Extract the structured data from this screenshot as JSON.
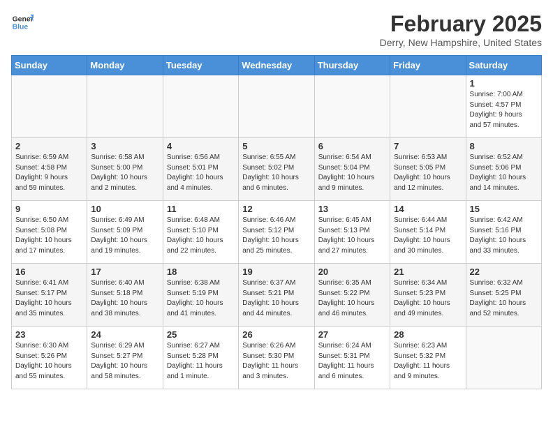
{
  "header": {
    "logo_line1": "General",
    "logo_line2": "Blue",
    "title": "February 2025",
    "subtitle": "Derry, New Hampshire, United States"
  },
  "days_of_week": [
    "Sunday",
    "Monday",
    "Tuesday",
    "Wednesday",
    "Thursday",
    "Friday",
    "Saturday"
  ],
  "weeks": [
    [
      {
        "day": "",
        "info": ""
      },
      {
        "day": "",
        "info": ""
      },
      {
        "day": "",
        "info": ""
      },
      {
        "day": "",
        "info": ""
      },
      {
        "day": "",
        "info": ""
      },
      {
        "day": "",
        "info": ""
      },
      {
        "day": "1",
        "info": "Sunrise: 7:00 AM\nSunset: 4:57 PM\nDaylight: 9 hours\nand 57 minutes."
      }
    ],
    [
      {
        "day": "2",
        "info": "Sunrise: 6:59 AM\nSunset: 4:58 PM\nDaylight: 9 hours\nand 59 minutes."
      },
      {
        "day": "3",
        "info": "Sunrise: 6:58 AM\nSunset: 5:00 PM\nDaylight: 10 hours\nand 2 minutes."
      },
      {
        "day": "4",
        "info": "Sunrise: 6:56 AM\nSunset: 5:01 PM\nDaylight: 10 hours\nand 4 minutes."
      },
      {
        "day": "5",
        "info": "Sunrise: 6:55 AM\nSunset: 5:02 PM\nDaylight: 10 hours\nand 6 minutes."
      },
      {
        "day": "6",
        "info": "Sunrise: 6:54 AM\nSunset: 5:04 PM\nDaylight: 10 hours\nand 9 minutes."
      },
      {
        "day": "7",
        "info": "Sunrise: 6:53 AM\nSunset: 5:05 PM\nDaylight: 10 hours\nand 12 minutes."
      },
      {
        "day": "8",
        "info": "Sunrise: 6:52 AM\nSunset: 5:06 PM\nDaylight: 10 hours\nand 14 minutes."
      }
    ],
    [
      {
        "day": "9",
        "info": "Sunrise: 6:50 AM\nSunset: 5:08 PM\nDaylight: 10 hours\nand 17 minutes."
      },
      {
        "day": "10",
        "info": "Sunrise: 6:49 AM\nSunset: 5:09 PM\nDaylight: 10 hours\nand 19 minutes."
      },
      {
        "day": "11",
        "info": "Sunrise: 6:48 AM\nSunset: 5:10 PM\nDaylight: 10 hours\nand 22 minutes."
      },
      {
        "day": "12",
        "info": "Sunrise: 6:46 AM\nSunset: 5:12 PM\nDaylight: 10 hours\nand 25 minutes."
      },
      {
        "day": "13",
        "info": "Sunrise: 6:45 AM\nSunset: 5:13 PM\nDaylight: 10 hours\nand 27 minutes."
      },
      {
        "day": "14",
        "info": "Sunrise: 6:44 AM\nSunset: 5:14 PM\nDaylight: 10 hours\nand 30 minutes."
      },
      {
        "day": "15",
        "info": "Sunrise: 6:42 AM\nSunset: 5:16 PM\nDaylight: 10 hours\nand 33 minutes."
      }
    ],
    [
      {
        "day": "16",
        "info": "Sunrise: 6:41 AM\nSunset: 5:17 PM\nDaylight: 10 hours\nand 35 minutes."
      },
      {
        "day": "17",
        "info": "Sunrise: 6:40 AM\nSunset: 5:18 PM\nDaylight: 10 hours\nand 38 minutes."
      },
      {
        "day": "18",
        "info": "Sunrise: 6:38 AM\nSunset: 5:19 PM\nDaylight: 10 hours\nand 41 minutes."
      },
      {
        "day": "19",
        "info": "Sunrise: 6:37 AM\nSunset: 5:21 PM\nDaylight: 10 hours\nand 44 minutes."
      },
      {
        "day": "20",
        "info": "Sunrise: 6:35 AM\nSunset: 5:22 PM\nDaylight: 10 hours\nand 46 minutes."
      },
      {
        "day": "21",
        "info": "Sunrise: 6:34 AM\nSunset: 5:23 PM\nDaylight: 10 hours\nand 49 minutes."
      },
      {
        "day": "22",
        "info": "Sunrise: 6:32 AM\nSunset: 5:25 PM\nDaylight: 10 hours\nand 52 minutes."
      }
    ],
    [
      {
        "day": "23",
        "info": "Sunrise: 6:30 AM\nSunset: 5:26 PM\nDaylight: 10 hours\nand 55 minutes."
      },
      {
        "day": "24",
        "info": "Sunrise: 6:29 AM\nSunset: 5:27 PM\nDaylight: 10 hours\nand 58 minutes."
      },
      {
        "day": "25",
        "info": "Sunrise: 6:27 AM\nSunset: 5:28 PM\nDaylight: 11 hours\nand 1 minute."
      },
      {
        "day": "26",
        "info": "Sunrise: 6:26 AM\nSunset: 5:30 PM\nDaylight: 11 hours\nand 3 minutes."
      },
      {
        "day": "27",
        "info": "Sunrise: 6:24 AM\nSunset: 5:31 PM\nDaylight: 11 hours\nand 6 minutes."
      },
      {
        "day": "28",
        "info": "Sunrise: 6:23 AM\nSunset: 5:32 PM\nDaylight: 11 hours\nand 9 minutes."
      },
      {
        "day": "",
        "info": ""
      }
    ]
  ]
}
